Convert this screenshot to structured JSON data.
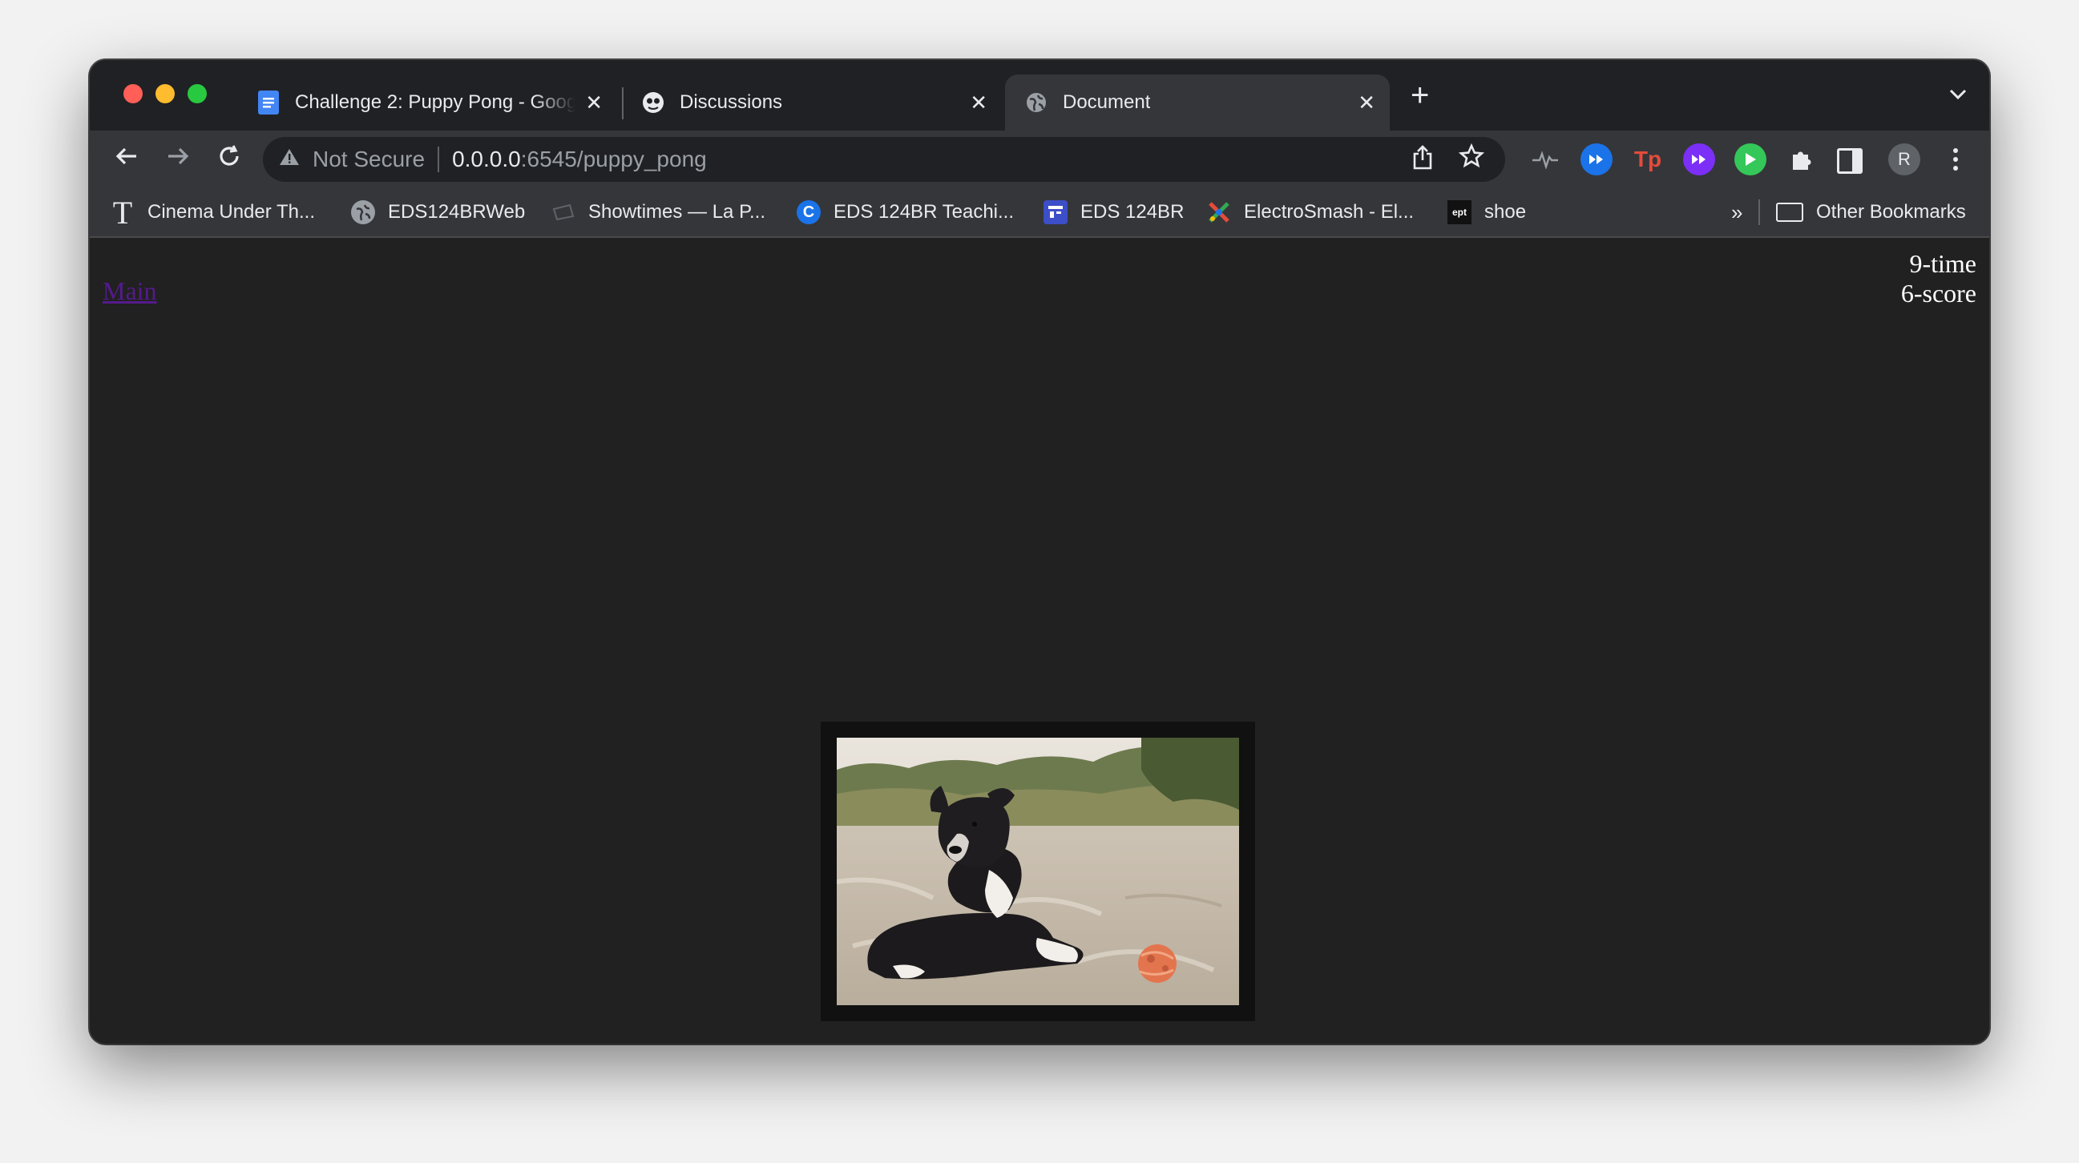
{
  "browser": {
    "tabs": [
      {
        "title": "Challenge 2: Puppy Pong - Google Docs",
        "icon": "google-docs-icon"
      },
      {
        "title": "Discussions",
        "icon": "discussions-icon"
      },
      {
        "title": "Document",
        "icon": "globe-icon",
        "active": true
      }
    ],
    "address": {
      "security_label": "Not Secure",
      "host": "0.0.0.0",
      "path": ":6545/puppy_pong"
    },
    "avatar_initial": "R",
    "bookmarks": [
      {
        "label": "Cinema Under Th...",
        "icon": "serif-t-icon"
      },
      {
        "label": "EDS124BRWeb",
        "icon": "globe-icon"
      },
      {
        "label": "Showtimes — La P...",
        "icon": "ticket-icon"
      },
      {
        "label": "EDS 124BR Teachi...",
        "icon": "c-logo-icon"
      },
      {
        "label": "EDS 124BR",
        "icon": "calendar-icon"
      },
      {
        "label": "ElectroSmash - El...",
        "icon": "electrosmash-icon"
      },
      {
        "label": "shoe",
        "icon": "ept-icon"
      }
    ],
    "bookmarks_more": "»",
    "other_bookmarks": "Other Bookmarks"
  },
  "page": {
    "main_link": "Main",
    "time_text": "9-time",
    "score_text": "6-score",
    "image_subject": "puppy-on-beach-with-ball"
  },
  "colors": {
    "page_background": "#212121",
    "link_visited": "#551a8b",
    "frame": "#111111"
  }
}
